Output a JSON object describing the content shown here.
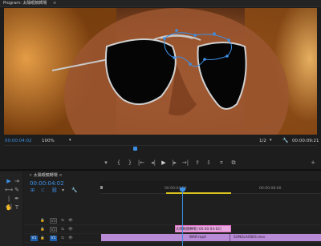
{
  "program_monitor": {
    "title": "Program: 太陽眼鏡轉場",
    "menu_glyph": "≡",
    "timecode_current": "00:00:04:02",
    "zoom": "100%",
    "resolution": "1/2",
    "timecode_duration": "00:00:09:21",
    "wrench_glyph": "🔧"
  },
  "transport": {
    "mark_in": "▾",
    "mark_out": "{",
    "mark_out2": "}",
    "go_in": "|←",
    "step_back": "◂|",
    "play": "▶",
    "step_fwd": "|▸",
    "go_out": "→|",
    "lift": "⇪",
    "extract": "⇩",
    "export_frame": "⌗",
    "compare": "⧉",
    "add": "+"
  },
  "timeline": {
    "tab_label": "太陽眼鏡轉場",
    "timecode": "00:00:04:02",
    "ruler_labels": [
      "00:00:04:00",
      "00:00:08:00"
    ],
    "tracks": [
      {
        "v": "V3",
        "src": ""
      },
      {
        "v": "V2",
        "src": "V2"
      },
      {
        "v": "V1",
        "src": "V1"
      }
    ],
    "clips": {
      "v2_label": "太陽眼鏡轉場 [00:00:04:02]",
      "v1_a_label": "WAR.mp4",
      "v1_b_label": "SUNGLASSES.mov"
    },
    "colors": {
      "accent": "#3d8fe3",
      "clip_purple": "#b98bd6",
      "clip_pink": "#e06fc4",
      "work_area": "#d8c21e"
    }
  },
  "tools": {
    "selection": "▶",
    "track_select": "⇥",
    "ripple": "⟷",
    "razor": "✎",
    "slip": "|↔|",
    "pen": "✒",
    "hand": "✋",
    "type": "T"
  }
}
